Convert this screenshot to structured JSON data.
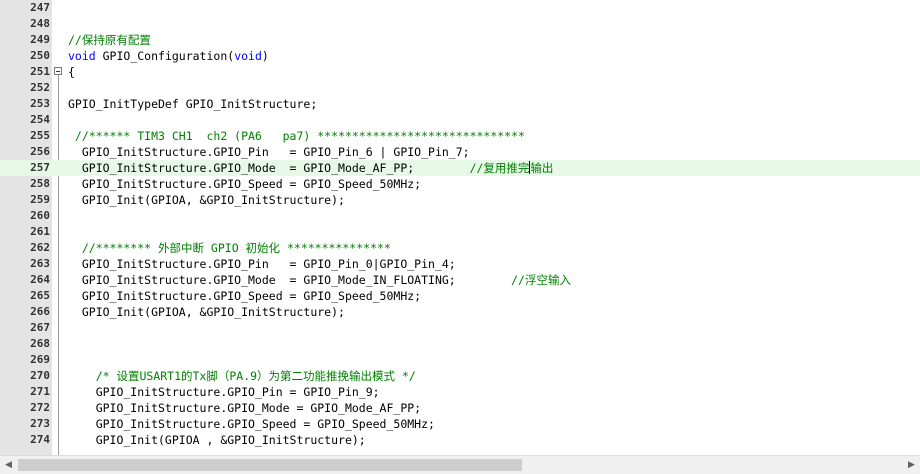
{
  "editor": {
    "lines": [
      {
        "num": "247",
        "segs": []
      },
      {
        "num": "248",
        "segs": []
      },
      {
        "num": "249",
        "segs": [
          {
            "t": "//保持原有配置",
            "c": "c"
          }
        ]
      },
      {
        "num": "250",
        "segs": [
          {
            "t": "void",
            "c": "k"
          },
          {
            "t": " GPIO_Configuration(",
            "c": ""
          },
          {
            "t": "void",
            "c": "k"
          },
          {
            "t": ")",
            "c": ""
          }
        ]
      },
      {
        "num": "251",
        "fold": true,
        "segs": [
          {
            "t": "{",
            "c": ""
          }
        ]
      },
      {
        "num": "252",
        "segs": []
      },
      {
        "num": "253",
        "segs": [
          {
            "t": "GPIO_InitTypeDef GPIO_InitStructure;",
            "c": ""
          }
        ]
      },
      {
        "num": "254",
        "segs": []
      },
      {
        "num": "255",
        "segs": [
          {
            "t": " //****** TIM3 CH1  ch2 (PA6   pa7) ******************************",
            "c": "c"
          }
        ]
      },
      {
        "num": "256",
        "segs": [
          {
            "t": "  GPIO_InitStructure.GPIO_Pin   = GPIO_Pin_6 | GPIO_Pin_7;",
            "c": ""
          }
        ]
      },
      {
        "num": "257",
        "current": true,
        "segs": [
          {
            "t": "  GPIO_InitStructure.GPIO_Mode  = GPIO_Mode_AF_PP;        ",
            "c": ""
          },
          {
            "t": "//复用推完",
            "c": "c"
          },
          {
            "caret": true
          },
          {
            "t": "输出",
            "c": "c"
          }
        ]
      },
      {
        "num": "258",
        "segs": [
          {
            "t": "  GPIO_InitStructure.GPIO_Speed = GPIO_Speed_50MHz;",
            "c": ""
          }
        ]
      },
      {
        "num": "259",
        "segs": [
          {
            "t": "  GPIO_Init(GPIOA, &GPIO_InitStructure);",
            "c": ""
          }
        ]
      },
      {
        "num": "260",
        "segs": []
      },
      {
        "num": "261",
        "segs": []
      },
      {
        "num": "262",
        "segs": [
          {
            "t": "  //******** 外部中断 GPIO 初始化 ***************",
            "c": "c"
          }
        ]
      },
      {
        "num": "263",
        "segs": [
          {
            "t": "  GPIO_InitStructure.GPIO_Pin   = GPIO_Pin_0|GPIO_Pin_4;",
            "c": ""
          }
        ]
      },
      {
        "num": "264",
        "segs": [
          {
            "t": "  GPIO_InitStructure.GPIO_Mode  = GPIO_Mode_IN_FLOATING;        ",
            "c": ""
          },
          {
            "t": "//浮空输入",
            "c": "c"
          }
        ]
      },
      {
        "num": "265",
        "segs": [
          {
            "t": "  GPIO_InitStructure.GPIO_Speed = GPIO_Speed_50MHz;",
            "c": ""
          }
        ]
      },
      {
        "num": "266",
        "segs": [
          {
            "t": "  GPIO_Init(GPIOA, &GPIO_InitStructure);",
            "c": ""
          }
        ]
      },
      {
        "num": "267",
        "segs": []
      },
      {
        "num": "268",
        "segs": []
      },
      {
        "num": "269",
        "segs": []
      },
      {
        "num": "270",
        "segs": [
          {
            "t": "    /* 设置USART1的Tx脚（PA.9）为第二功能推挽输出模式 */",
            "c": "c"
          }
        ]
      },
      {
        "num": "271",
        "segs": [
          {
            "t": "    GPIO_InitStructure.GPIO_Pin = GPIO_Pin_9;",
            "c": ""
          }
        ]
      },
      {
        "num": "272",
        "segs": [
          {
            "t": "    GPIO_InitStructure.GPIO_Mode = GPIO_Mode_AF_PP;",
            "c": ""
          }
        ]
      },
      {
        "num": "273",
        "segs": [
          {
            "t": "    GPIO_InitStructure.GPIO_Speed = GPIO_Speed_50MHz;",
            "c": ""
          }
        ]
      },
      {
        "num": "274",
        "segs": [
          {
            "t": "    GPIO_Init(GPIOA , &GPIO_InitStructure);",
            "c": ""
          }
        ]
      }
    ]
  },
  "scrollbar": {
    "left_icon": "chevron-left-icon",
    "right_icon": "chevron-right-icon",
    "position": 0.0,
    "visible_fraction": 0.57
  },
  "colors": {
    "comment": "#008000",
    "keyword": "#0000ff",
    "current_line": "#e8f8e8",
    "gutter": "#e4e4e4"
  }
}
